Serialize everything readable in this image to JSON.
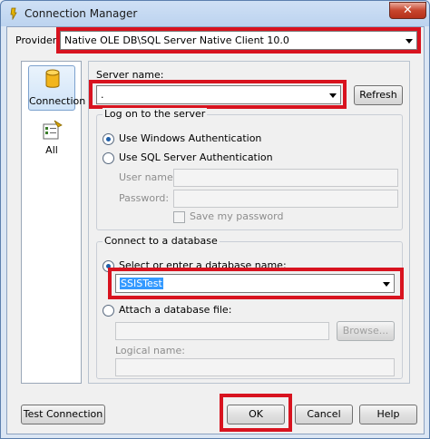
{
  "window": {
    "title": "Connection Manager",
    "close_glyph": "✕"
  },
  "provider": {
    "label": "Provider:",
    "value": "Native OLE DB\\SQL Server Native Client 10.0"
  },
  "sidebar": {
    "items": [
      {
        "label": "Connection",
        "icon": "database-icon"
      },
      {
        "label": "All",
        "icon": "properties-icon"
      }
    ]
  },
  "server": {
    "label": "Server name:",
    "value": ".",
    "refresh_label": "Refresh"
  },
  "logon": {
    "title": "Log on to the server",
    "windows_auth": "Use Windows Authentication",
    "sql_auth": "Use SQL Server Authentication",
    "username_label": "User name:",
    "password_label": "Password:",
    "save_password": "Save my password"
  },
  "database": {
    "title": "Connect to a database",
    "select_label": "Select or enter a database name:",
    "selected_db": "SSISTest",
    "attach_label": "Attach a database file:",
    "browse_label": "Browse...",
    "logical_label": "Logical name:"
  },
  "footer": {
    "test_label": "Test Connection",
    "ok_label": "OK",
    "cancel_label": "Cancel",
    "help_label": "Help"
  },
  "colors": {
    "highlight_red": "#d8131f",
    "selection_blue": "#3399ff"
  }
}
